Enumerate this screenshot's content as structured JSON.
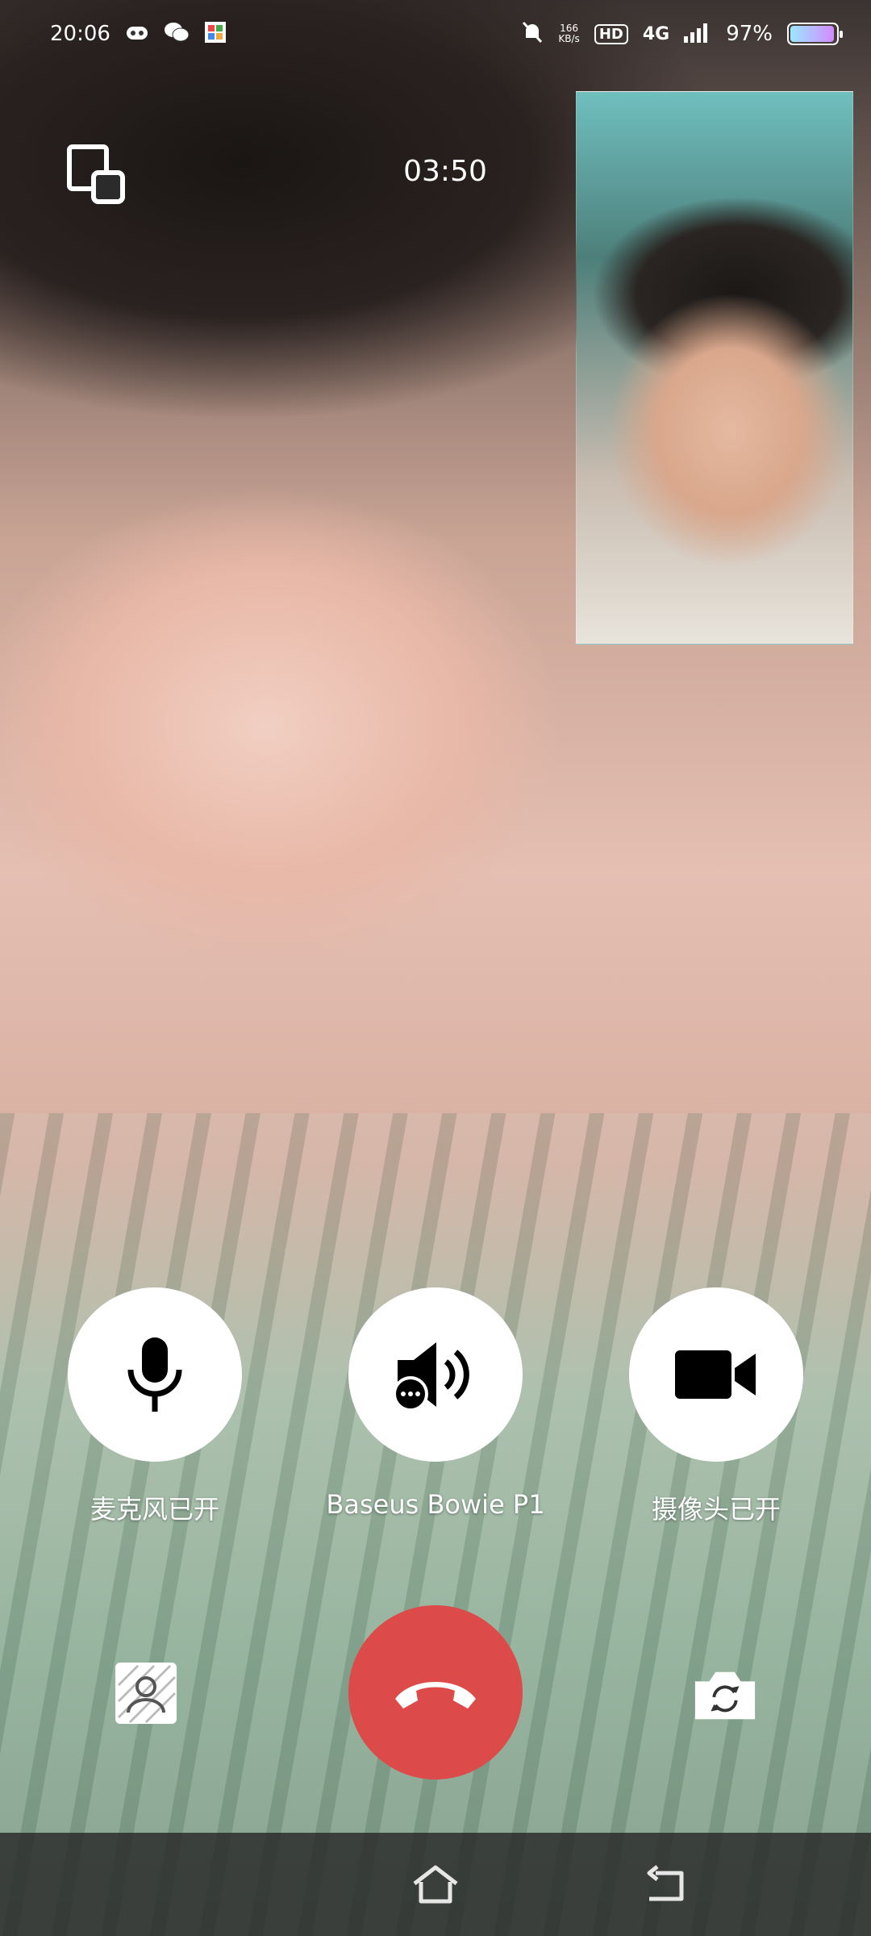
{
  "status_bar": {
    "time": "20:06",
    "net_speed_value": "166",
    "net_speed_unit": "KB/s",
    "hd": "HD",
    "network": "4G",
    "battery": "97%",
    "battery_level": 0.97
  },
  "call": {
    "timer": "03:50"
  },
  "controls": {
    "mic_label": "麦克风已开",
    "audio_label": "Baseus Bowie P1",
    "camera_label": "摄像头已开"
  },
  "colors": {
    "end_call": "#dc4a4a",
    "control_bg": "#ffffff"
  }
}
